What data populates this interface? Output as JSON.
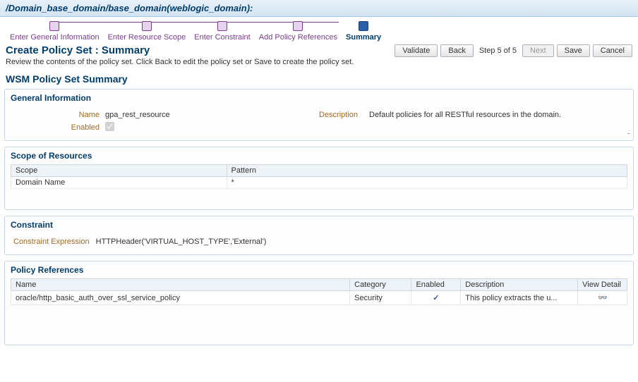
{
  "header": {
    "breadcrumb": "/Domain_base_domain/base_domain(weblogic_domain):"
  },
  "wizard": {
    "steps": [
      {
        "label": "Enter General Information"
      },
      {
        "label": "Enter Resource Scope"
      },
      {
        "label": "Enter Constraint"
      },
      {
        "label": "Add Policy References"
      },
      {
        "label": "Summary"
      }
    ],
    "current_index": 4
  },
  "title": {
    "main": "Create Policy Set : Summary",
    "sub": "Review the contents of the policy set. Click Back to edit the policy set or Save to create the policy set."
  },
  "actions": {
    "validate": "Validate",
    "back": "Back",
    "step_text": "Step 5 of 5",
    "next": "Next",
    "save": "Save",
    "cancel": "Cancel"
  },
  "summary": {
    "section_title": "WSM Policy Set Summary",
    "general": {
      "heading": "General Information",
      "name_label": "Name",
      "name_value": "gpa_rest_resource",
      "enabled_label": "Enabled",
      "enabled_checked": true,
      "description_label": "Description",
      "description_value": "Default policies for all RESTful resources in the domain."
    },
    "scope": {
      "heading": "Scope of Resources",
      "columns": {
        "scope": "Scope",
        "pattern": "Pattern"
      },
      "rows": [
        {
          "scope": "Domain Name",
          "pattern": "*"
        }
      ]
    },
    "constraint": {
      "heading": "Constraint",
      "label": "Constraint Expression",
      "value": "HTTPHeader('VIRTUAL_HOST_TYPE','External')"
    },
    "policy_refs": {
      "heading": "Policy References",
      "columns": {
        "name": "Name",
        "category": "Category",
        "enabled": "Enabled",
        "description": "Description",
        "view_detail": "View Detail"
      },
      "rows": [
        {
          "name": "oracle/http_basic_auth_over_ssl_service_policy",
          "category": "Security",
          "enabled": true,
          "description": "This policy extracts the u..."
        }
      ]
    }
  }
}
